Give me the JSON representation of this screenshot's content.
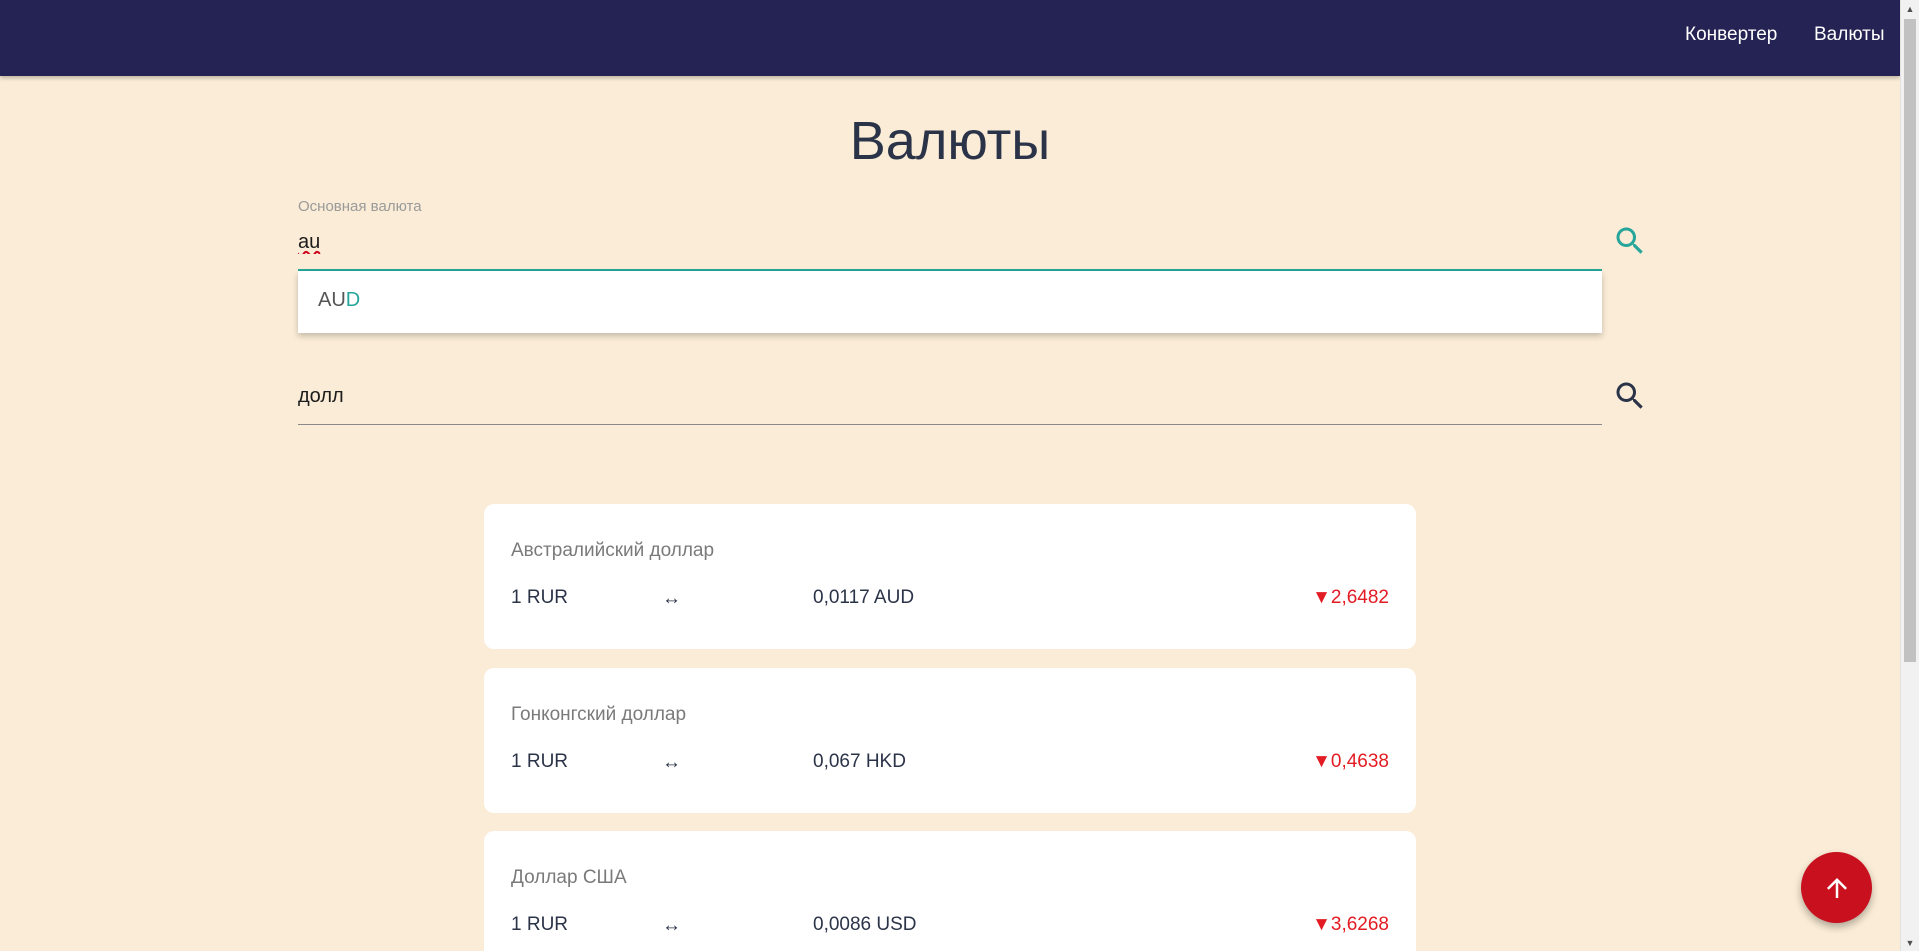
{
  "nav": {
    "links": [
      "Конвертер",
      "Валюты"
    ]
  },
  "page": {
    "title": "Валюты"
  },
  "base_currency": {
    "label": "Основная валюта",
    "value": "au",
    "search_icon": "search-icon",
    "active_color": "#26a69a"
  },
  "autocomplete": {
    "option_match": "AU",
    "option_rest": "D"
  },
  "filter": {
    "value": "долл",
    "search_icon": "search-icon"
  },
  "currencies": [
    {
      "name": "Австралийский доллар",
      "from": "1 RUR",
      "arrow": "↔",
      "to": "0,0117 AUD",
      "change": "▼2,6482"
    },
    {
      "name": "Гонконгский доллар",
      "from": "1 RUR",
      "arrow": "↔",
      "to": "0,067 HKD",
      "change": "▼0,4638"
    },
    {
      "name": "Доллар США",
      "from": "1 RUR",
      "arrow": "↔",
      "to": "0,0086 USD",
      "change": "▼3,6268"
    }
  ],
  "fab": {
    "icon": "arrow-up-icon"
  },
  "colors": {
    "navbar": "#252353",
    "background": "#faecd6",
    "accent": "#26a69a",
    "negative": "#e31b23",
    "fab": "#c8101e"
  }
}
